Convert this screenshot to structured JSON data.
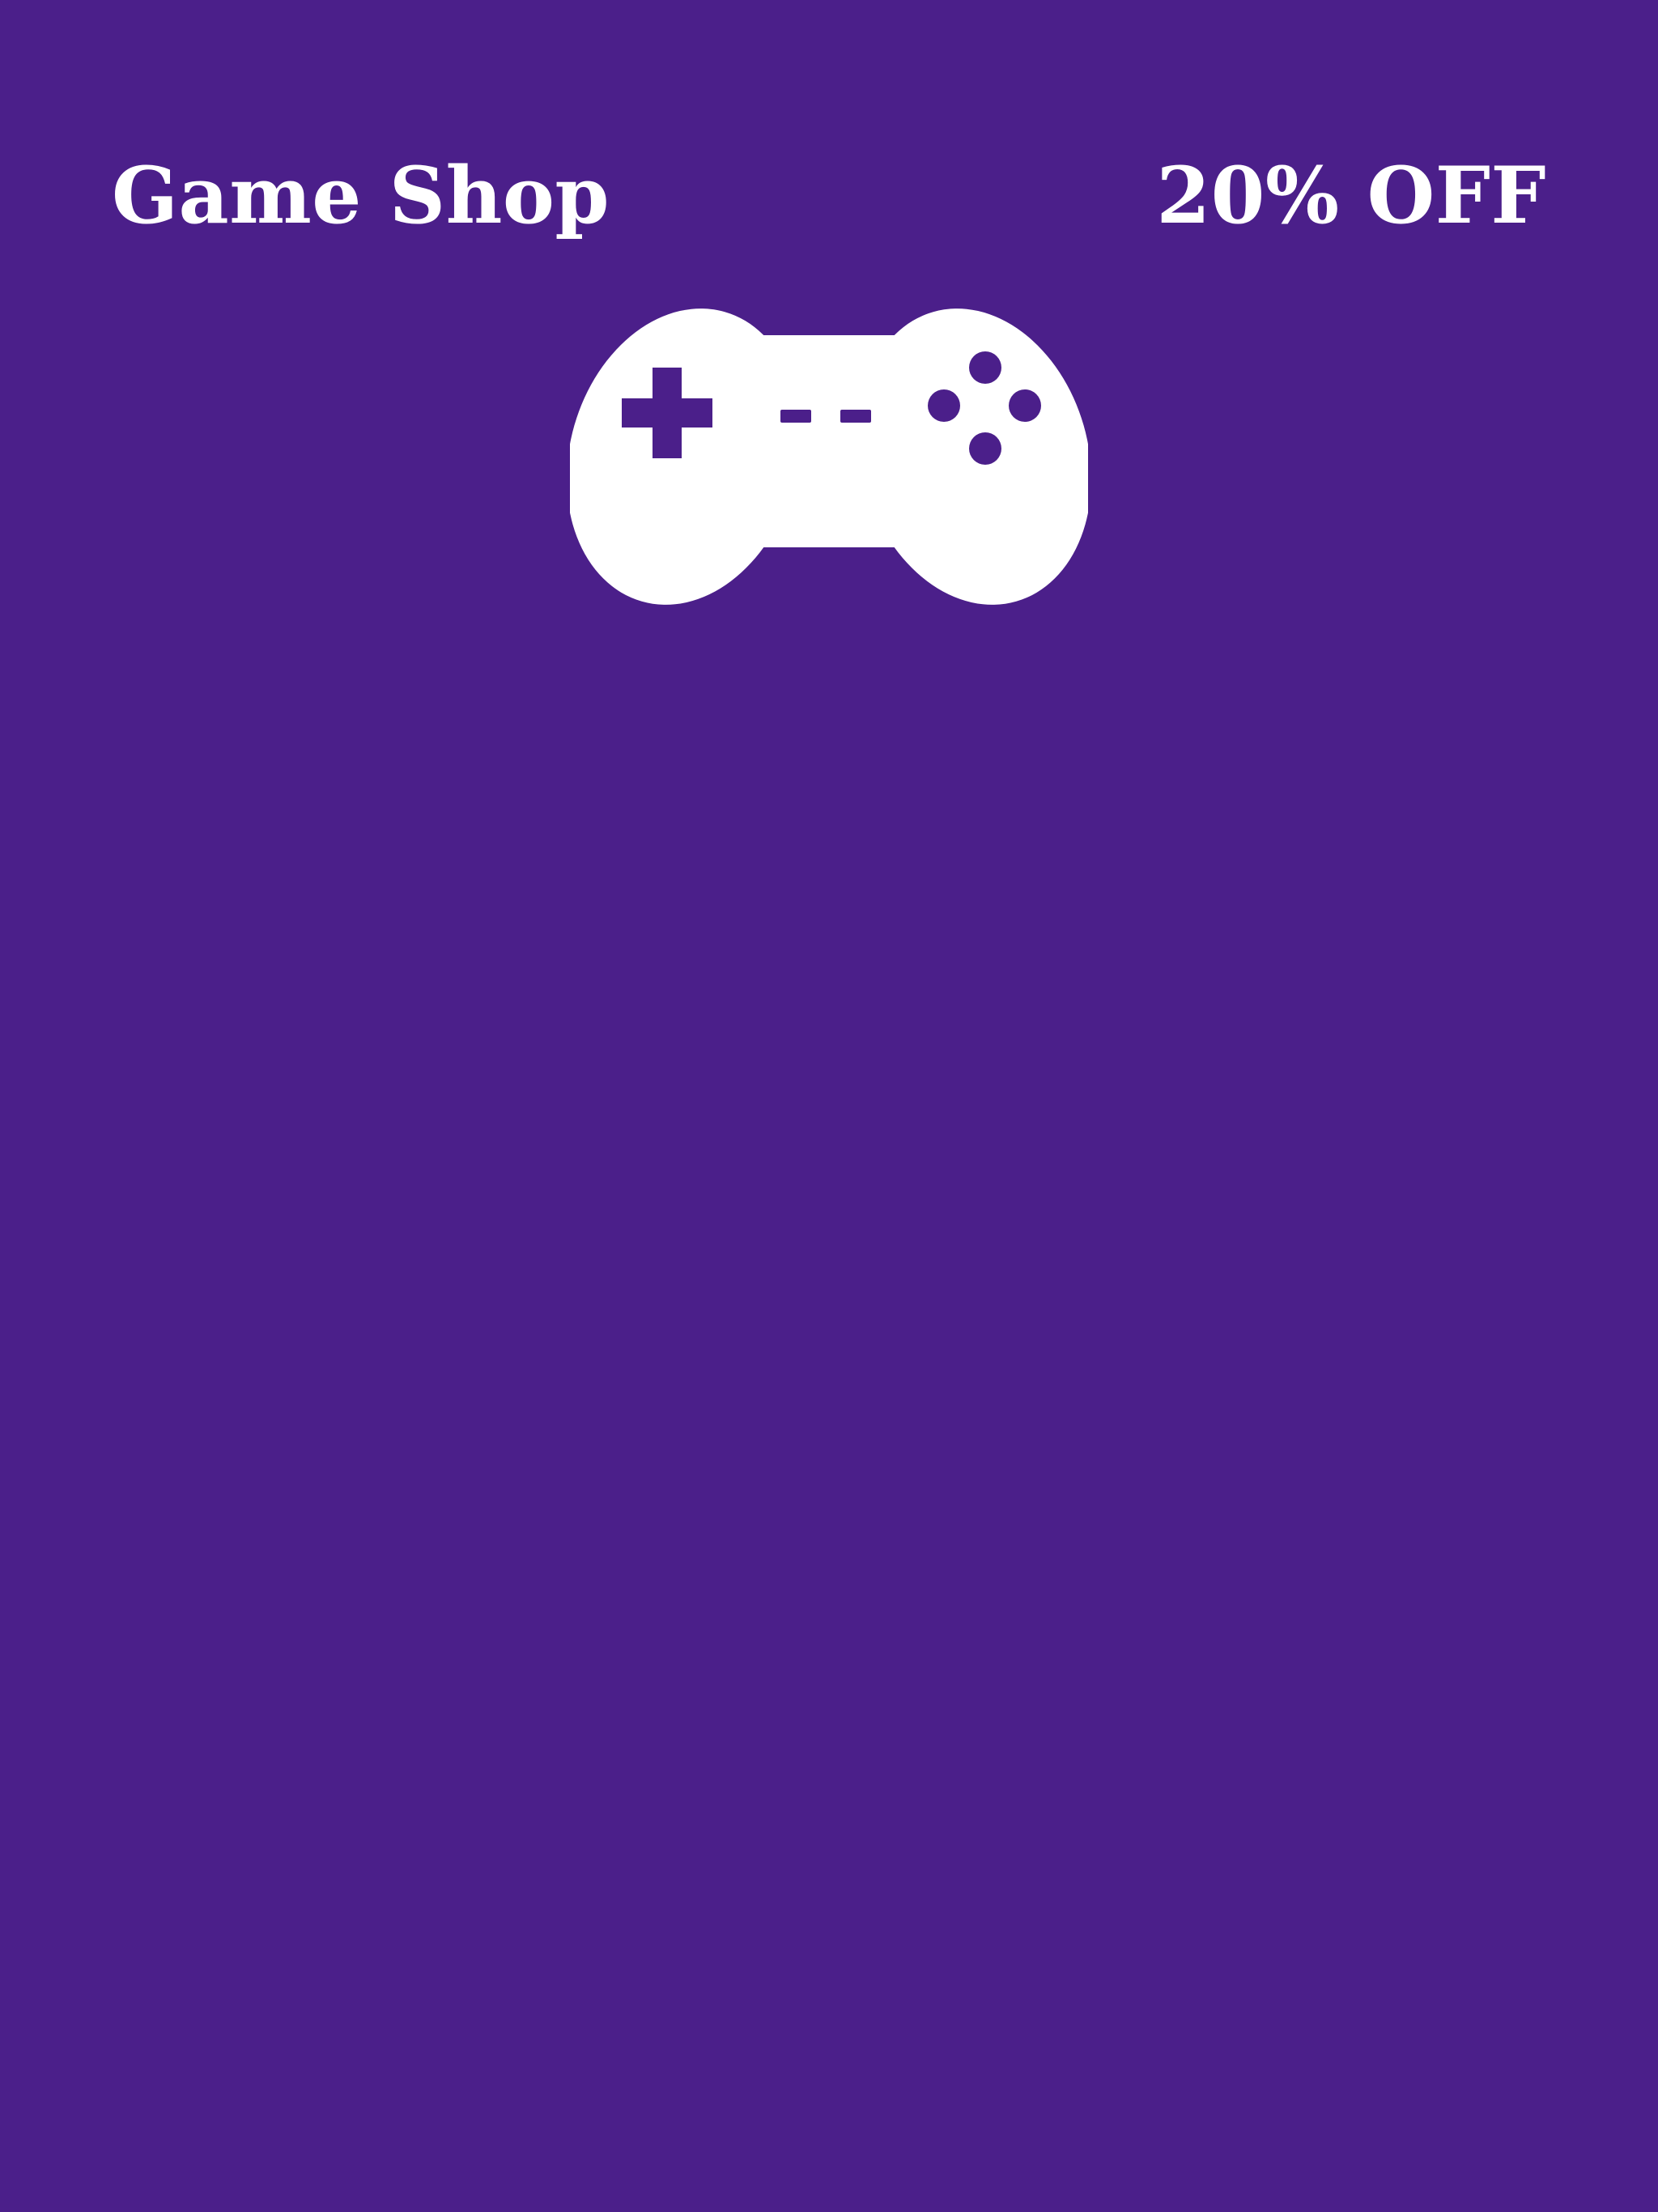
{
  "header": {
    "title": "Game Shop",
    "discount": "20% OFF"
  },
  "hero": {
    "icon": "gamepad-icon"
  },
  "colors": {
    "background": "#4b1f8a",
    "foreground": "#ffffff"
  }
}
